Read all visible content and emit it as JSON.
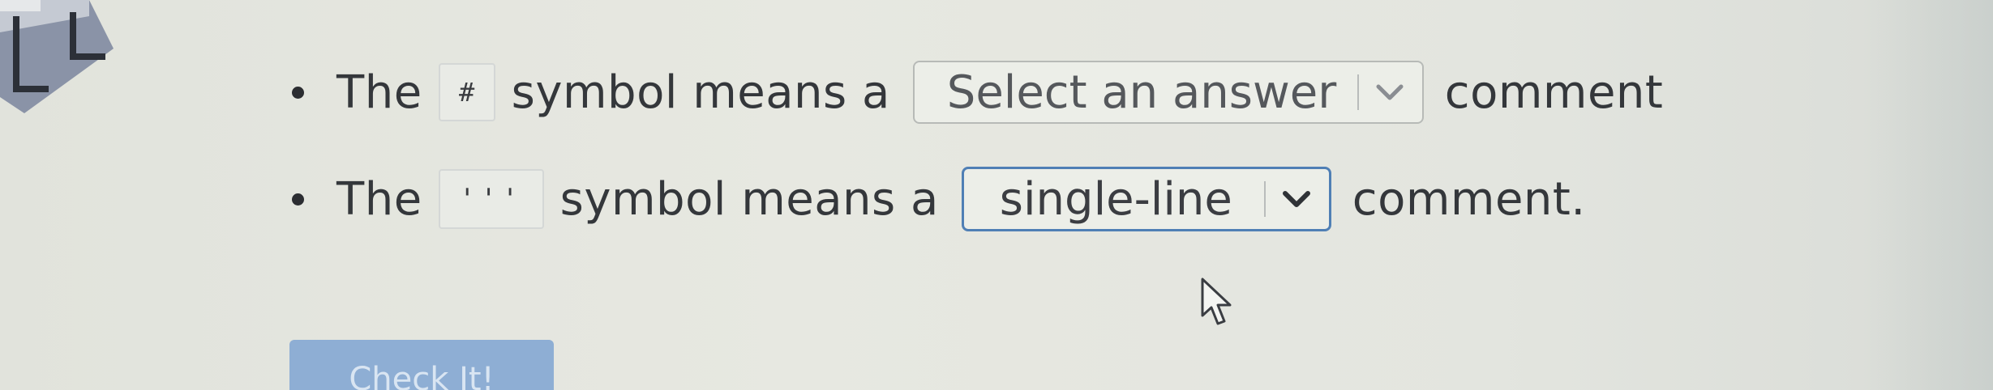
{
  "statements": [
    {
      "prefix": "The",
      "symbol": "#",
      "middle": "symbol means a",
      "select_value": "Select an answer",
      "suffix": "comment"
    },
    {
      "prefix": "The",
      "symbol": "'''",
      "middle": "symbol means a",
      "select_value": "single-line",
      "suffix": "comment."
    }
  ],
  "check_button": {
    "label": "Check It!"
  },
  "colors": {
    "select_focus_border": "#4f7fb5",
    "check_button_bg": "#8eaed4"
  },
  "icons": [
    "chevron-down-icon",
    "mouse-cursor-icon",
    "bullet-icon"
  ]
}
